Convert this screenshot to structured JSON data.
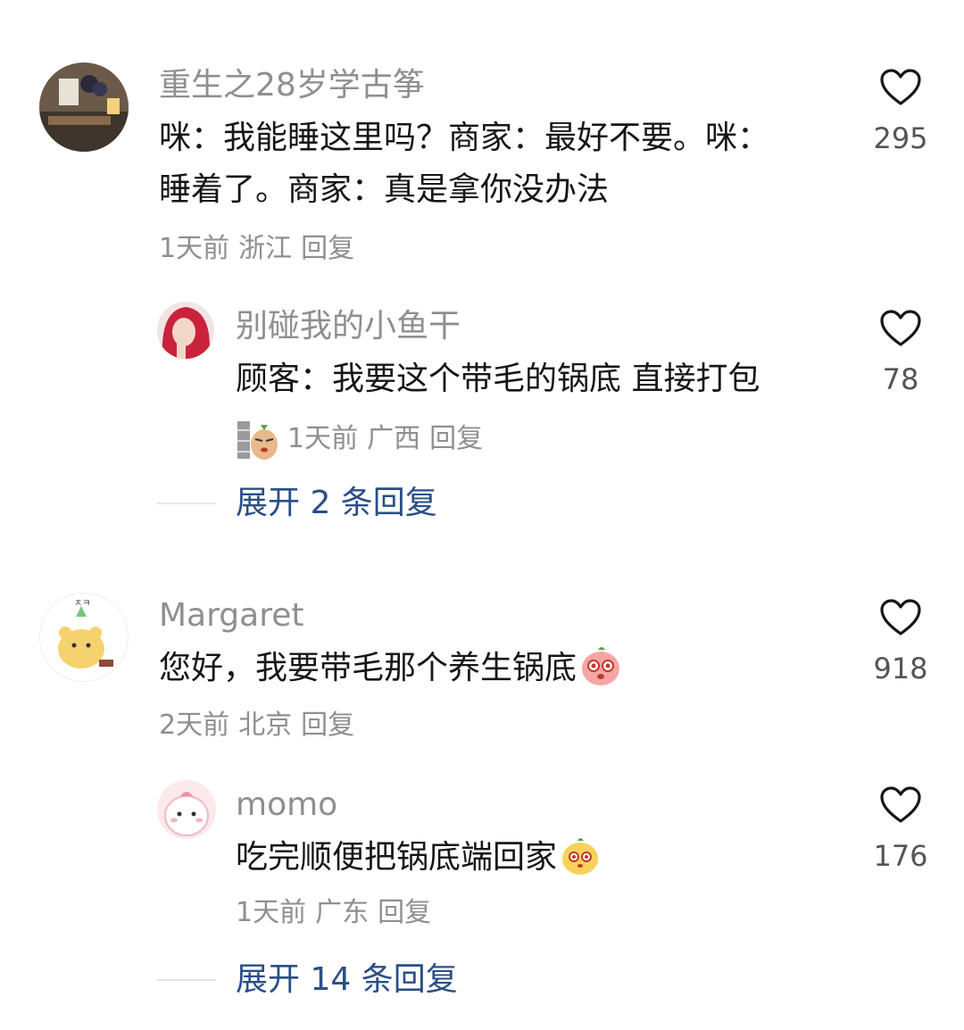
{
  "comments": [
    {
      "username": "重生之28岁学古筝",
      "text_line1": "咪：我能睡这里吗？商家：最好不要。咪：",
      "text_line2": "睡着了。商家：真是拿你没办法",
      "time": "1天前",
      "location": "浙江",
      "reply_label": "回复",
      "likes": "295",
      "reply": {
        "username": "别碰我的小鱼干",
        "text": "顾客：我要这个带毛的锅底 直接打包",
        "time": "1天前",
        "location": "广西",
        "reply_label": "回复",
        "likes": "78",
        "emoji_icon": "peeking-potato-emoji-icon"
      },
      "expand_label": "展开 2 条回复"
    },
    {
      "username": "Margaret",
      "text": "您好，我要带毛那个养生锅底",
      "emoji_icon": "pink-blob-emoji-icon",
      "time": "2天前",
      "location": "北京",
      "reply_label": "回复",
      "likes": "918",
      "reply": {
        "username": "momo",
        "text": "吃完顺便把锅底端回家",
        "emoji_icon": "yellow-blob-emoji-icon",
        "time": "1天前",
        "location": "广东",
        "reply_label": "回复",
        "likes": "176"
      },
      "expand_label": "展开 14 条回复"
    }
  ],
  "colors": {
    "username": "#8f8f8f",
    "link": "#2a4f86",
    "text": "#161616"
  }
}
